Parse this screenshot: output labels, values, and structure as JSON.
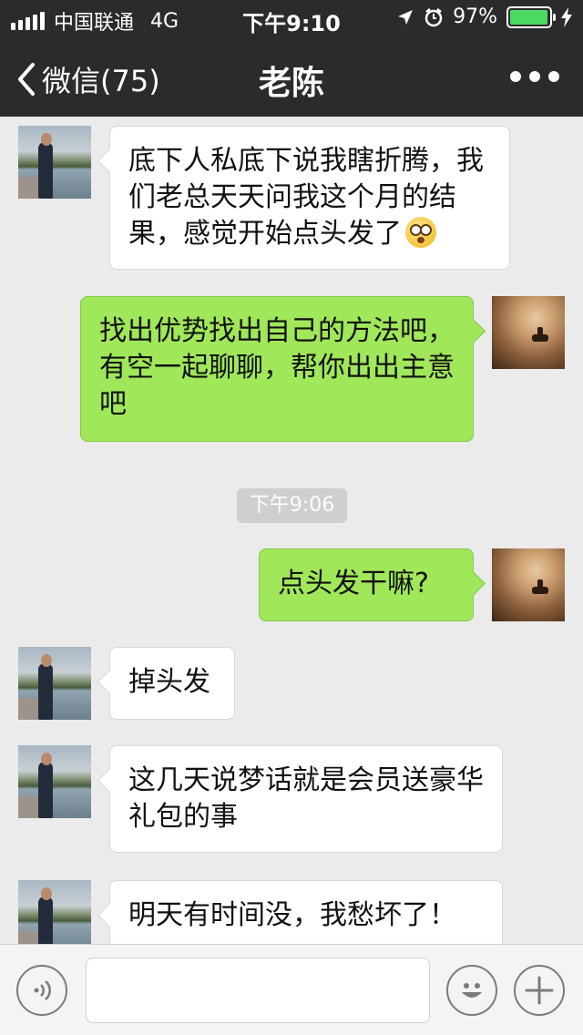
{
  "status_bar": {
    "carrier": "中国联通",
    "network": "4G",
    "time": "下午9:10",
    "battery": "97%",
    "battery_level": 0.97
  },
  "nav": {
    "back_label": "微信(75)",
    "title": "老陈"
  },
  "messages": [
    {
      "from": "friend",
      "text": "底下人私底下说我瞎折腾，我们老总天天问我这个月的结果，感觉开始点头发了",
      "emoji": "flushed-face"
    },
    {
      "from": "me",
      "text": "找出优势找出自己的方法吧，有空一起聊聊，帮你出出主意吧"
    },
    {
      "type": "timestamp",
      "text": "下午9:06"
    },
    {
      "from": "me",
      "text": "点头发干嘛?"
    },
    {
      "from": "friend",
      "text": "掉头发"
    },
    {
      "from": "friend",
      "text": "这几天说梦话就是会员送豪华礼包的事"
    },
    {
      "from": "friend",
      "text": "明天有时间没，我愁坏了！"
    }
  ],
  "input_bar": {
    "voice_icon": "voice-icon",
    "emoji_icon": "emoji-icon",
    "plus_icon": "plus-icon",
    "input_value": ""
  },
  "colors": {
    "header_bg": "#2b2b2e",
    "chat_bg": "#ebebeb",
    "outgoing_bubble": "#a0e75a",
    "incoming_bubble": "#ffffff",
    "battery_fill": "#4cd964"
  }
}
